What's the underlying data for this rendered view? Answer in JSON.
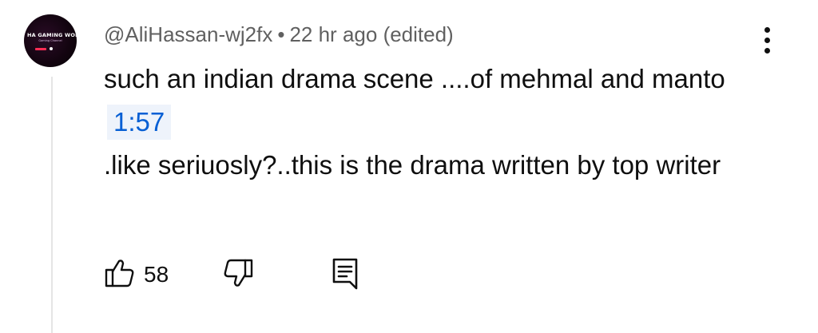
{
  "comment": {
    "avatar": {
      "title_text": "HA GAMING WORL",
      "subtitle_text": "Gaming Channel"
    },
    "author": "@AliHassan-wj2fx",
    "separator": "•",
    "time_ago": "22 hr ago",
    "edited_label": "(edited)",
    "text_part1": "such an indian drama scene ....of mehmal and manto",
    "timestamp_link": "1:57",
    "text_part2": ".like seriuosly?..this is the drama written by top writer",
    "like_count": "58",
    "icons": {
      "menu": "more-vert-icon",
      "like": "thumbs-up-icon",
      "dislike": "thumbs-down-icon",
      "reply": "reply-icon"
    },
    "colors": {
      "link": "#065fd4",
      "link_bg": "#eef3fb",
      "meta_text": "#606060",
      "thread_line": "#e5e5e5"
    }
  }
}
